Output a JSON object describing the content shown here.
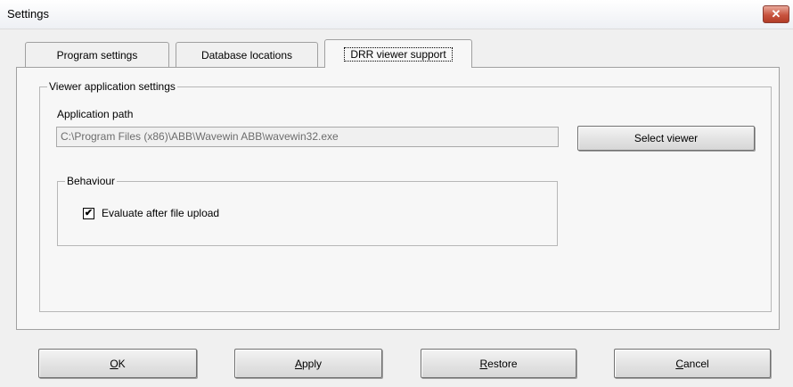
{
  "window": {
    "title": "Settings",
    "close_glyph": "✕"
  },
  "tabs": [
    {
      "label": "Program settings"
    },
    {
      "label": "Database locations"
    },
    {
      "label": "DRR viewer support"
    }
  ],
  "viewer_group": {
    "legend": "Viewer application settings",
    "app_path_label": "Application path",
    "app_path_value": "C:\\Program Files (x86)\\ABB\\Wavewin ABB\\wavewin32.exe",
    "select_viewer_label": "Select viewer"
  },
  "behaviour_group": {
    "legend": "Behaviour",
    "evaluate_checkbox": {
      "label": "Evaluate after file upload",
      "checked": true,
      "glyph": "✔"
    }
  },
  "footer": {
    "ok": {
      "mnemonic": "O",
      "rest": "K"
    },
    "apply": {
      "mnemonic": "A",
      "rest": "pply"
    },
    "restore": {
      "mnemonic": "R",
      "rest": "estore"
    },
    "cancel": {
      "mnemonic": "C",
      "rest": "ancel"
    }
  }
}
